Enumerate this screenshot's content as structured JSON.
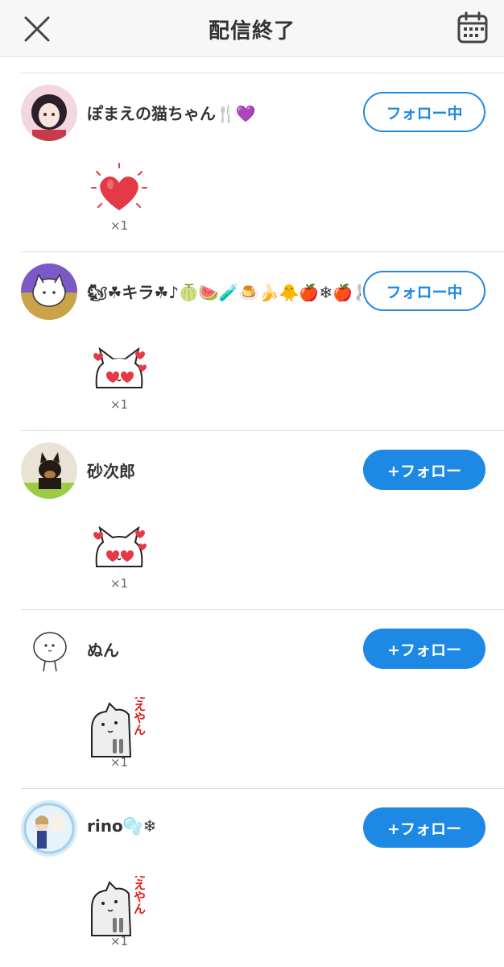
{
  "header": {
    "title": "配信終了",
    "close_icon": "close-icon",
    "calendar_icon": "calendar-icon"
  },
  "viewers": [
    {
      "name": "ぽまえの猫ちゃん🍴💜",
      "button": "フォロー中",
      "following": true,
      "gift": "heart",
      "count": "×1"
    },
    {
      "name": "🐿☘キラ☘♪🍈🍉🧪🍮🍌🐥🍎❄🍎🐰🌸",
      "button": "フォロー中",
      "following": true,
      "gift": "love-cat",
      "count": "×1"
    },
    {
      "name": "砂次郎",
      "button": "+フォロー",
      "following": false,
      "gift": "love-cat",
      "count": "×1"
    },
    {
      "name": "ぬん",
      "button": "+フォロー",
      "following": false,
      "gift": "eeyan-cat",
      "count": "×1"
    },
    {
      "name": "rino🫧❄",
      "button": "+フォロー",
      "following": false,
      "gift": "eeyan-cat",
      "count": "×1"
    }
  ],
  "stickers": {
    "eeyan_text": "ええやん"
  },
  "colors": {
    "accent": "#1e88e5",
    "heart": "#e53945"
  }
}
